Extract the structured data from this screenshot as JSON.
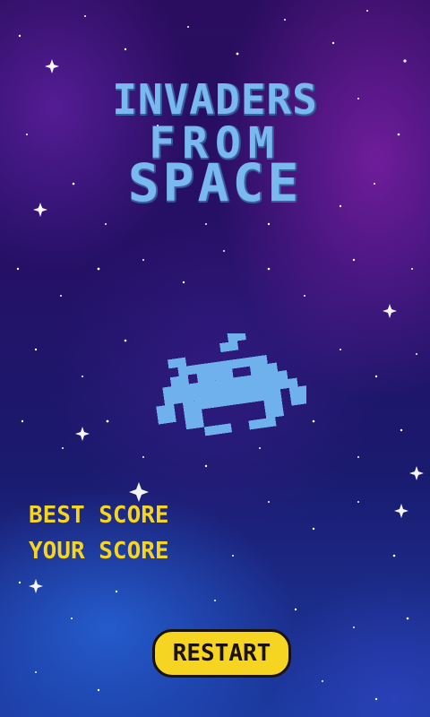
{
  "title": {
    "line1": "INVADERS",
    "line2": "FROM",
    "line3": "SPACE"
  },
  "scores": {
    "best_label": "BEST SCORE",
    "your_label": "YOUR SCORE"
  },
  "controls": {
    "restart_label": "RESTART"
  },
  "icons": {
    "mascot": "space-invader-icon"
  },
  "colors": {
    "title": "#7ab8f0",
    "invader": "#6fb1ec",
    "score_text": "#f5d422",
    "button_fill": "#f5d422",
    "button_text": "#1a1206"
  }
}
